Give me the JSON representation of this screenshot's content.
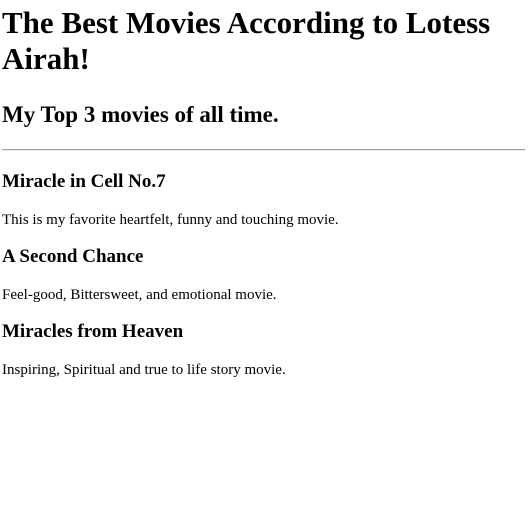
{
  "header": {
    "title": "The Best Movies According to Lotess Airah!",
    "subtitle": "My Top 3 movies of all time."
  },
  "movies": [
    {
      "title": "Miracle in Cell No.7",
      "description": "This is my favorite heartfelt, funny and touching movie."
    },
    {
      "title": "A Second Chance",
      "description": "Feel-good, Bittersweet, and emotional movie."
    },
    {
      "title": "Miracles from Heaven",
      "description": "Inspiring, Spiritual and true to life story movie."
    }
  ]
}
